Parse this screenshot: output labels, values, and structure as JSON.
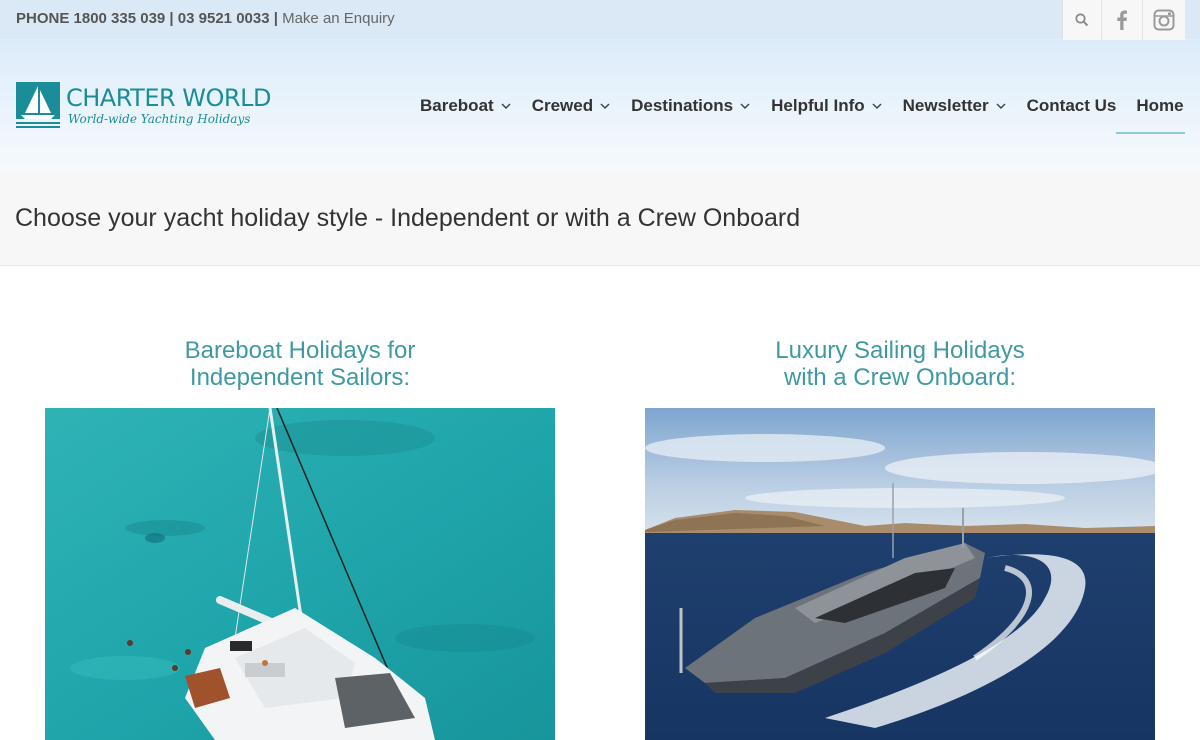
{
  "topbar": {
    "phone_label": "PHONE 1800 335 039 | 03 9521 0033 |",
    "enquiry_link": "Make an Enquiry",
    "icons": [
      "search-icon",
      "facebook-icon",
      "instagram-icon"
    ]
  },
  "logo": {
    "name": "CHARTER WORLD",
    "tagline": "World-wide Yachting Holidays"
  },
  "nav": {
    "items": [
      {
        "label": "Bareboat",
        "has_dropdown": true
      },
      {
        "label": "Crewed",
        "has_dropdown": true
      },
      {
        "label": "Destinations",
        "has_dropdown": true
      },
      {
        "label": "Helpful Info",
        "has_dropdown": true
      },
      {
        "label": "Newsletter",
        "has_dropdown": true
      },
      {
        "label": "Contact Us",
        "has_dropdown": false
      },
      {
        "label": "Home",
        "has_dropdown": false,
        "active": true
      }
    ]
  },
  "page": {
    "title": "Choose your yacht holiday style - Independent or with a Crew Onboard"
  },
  "sections": [
    {
      "heading_line1": "Bareboat Holidays for",
      "heading_line2": "Independent Sailors:",
      "image": "catamaran-aerial-photo"
    },
    {
      "heading_line1": "Luxury Sailing Holidays",
      "heading_line2": "with a Crew Onboard:",
      "image": "motor-yacht-photo"
    }
  ],
  "colors": {
    "brand_teal": "#1a8d98",
    "heading_teal": "#3f99a3",
    "topbar_bg": "#dbe9f7",
    "active_underline": "#8fc8d8"
  }
}
